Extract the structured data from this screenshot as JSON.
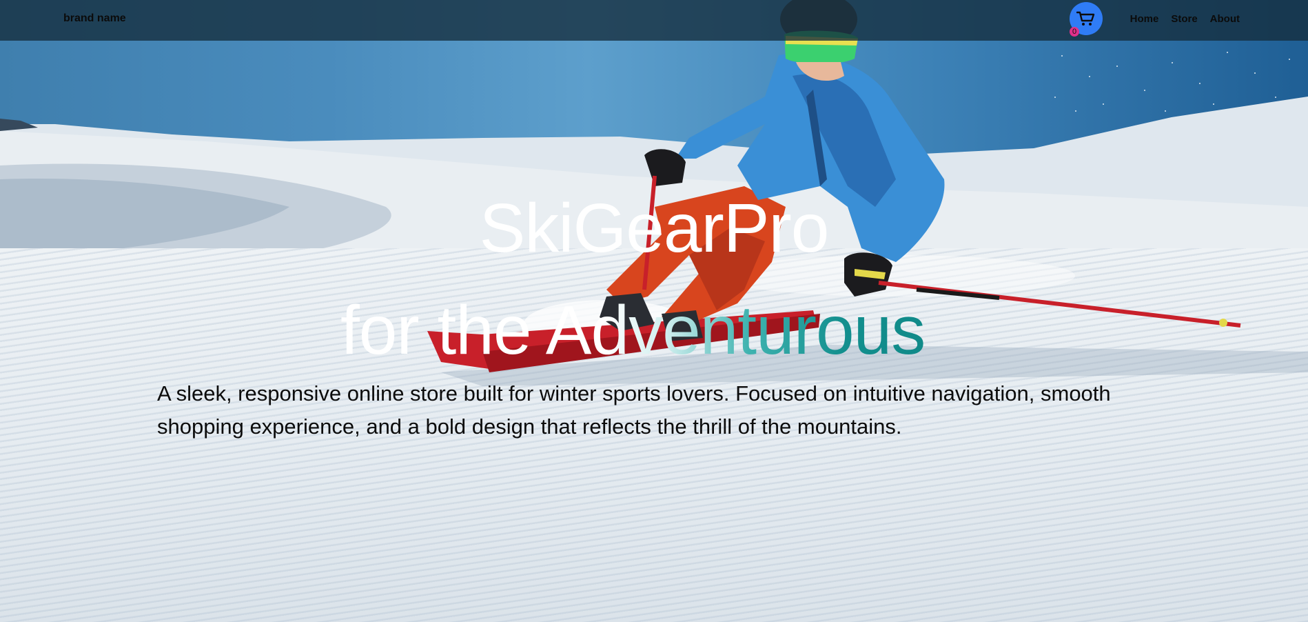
{
  "navbar": {
    "brand": "brand name",
    "cart_count": "0",
    "links": [
      "Home",
      "Store",
      "About"
    ]
  },
  "hero": {
    "title": "SkiGearPro",
    "subtitle": "for the Adventurous",
    "description": "A sleek, responsive online store built for winter sports lovers. Focused on intuitive navigation, smooth shopping experience, and a bold design that reflects the thrill of the mountains."
  },
  "icons": {
    "cart": "shopping-cart-icon"
  },
  "colors": {
    "navbar_bg": "#142d3c",
    "cart_button": "#2f7cf6",
    "cart_badge": "#e0308a",
    "accent_teal": "#138f8e"
  }
}
